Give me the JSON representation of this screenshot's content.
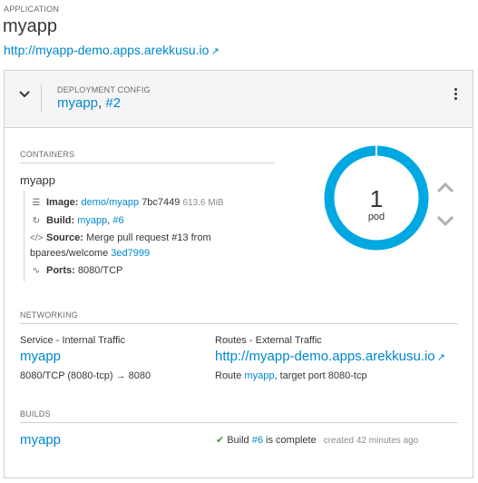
{
  "application": {
    "section_label": "APPLICATION",
    "name": "myapp",
    "url": "http://myapp-demo.apps.arekkusu.io",
    "url_icon": "external-link-icon"
  },
  "deployment": {
    "section_label": "DEPLOYMENT CONFIG",
    "name": "myapp",
    "separator": ", ",
    "revision": "#2",
    "expand_icon": "chevron-down-icon",
    "actions_icon": "kebab-menu-icon"
  },
  "containers": {
    "section_label": "CONTAINERS",
    "name": "myapp",
    "image": {
      "label": "Image:",
      "repo": "demo/myapp",
      "digest": "7bc7449",
      "size": "613.6 MiB",
      "icon": "image-stack-icon"
    },
    "build": {
      "label": "Build:",
      "name": "myapp",
      "separator": ", ",
      "number": "#6",
      "icon": "refresh-icon"
    },
    "source": {
      "label": "Source:",
      "text": "Merge pull request #13 from bparees/welcome",
      "commit": "3ed7999",
      "icon": "code-icon"
    },
    "ports": {
      "label": "Ports:",
      "value": "8080/TCP",
      "icon": "pulse-icon"
    }
  },
  "pods": {
    "count": "1",
    "label": "pod",
    "ring_color": "#00a8e1",
    "scale_up_icon": "chevron-up-icon",
    "scale_down_icon": "chevron-down-icon"
  },
  "networking": {
    "section_label": "NETWORKING",
    "service": {
      "title": "Service - Internal Traffic",
      "name": "myapp",
      "ports": "8080/TCP (8080-tcp) → 8080"
    },
    "route": {
      "title": "Routes - External Traffic",
      "url": "http://myapp-demo.apps.arekkusu.io",
      "prefix": "Route ",
      "name": "myapp",
      "suffix": ", target port 8080-tcp"
    }
  },
  "builds": {
    "section_label": "BUILDS",
    "name": "myapp",
    "status_prefix": "Build ",
    "number": "#6",
    "status_suffix": " is complete",
    "created": "created 42 minutes ago",
    "status_icon": "check-icon",
    "status_color": "#3f9c35"
  },
  "colors": {
    "link": "#0088ce",
    "header_bg": "#f5f5f5",
    "border": "#d1d1d1"
  }
}
